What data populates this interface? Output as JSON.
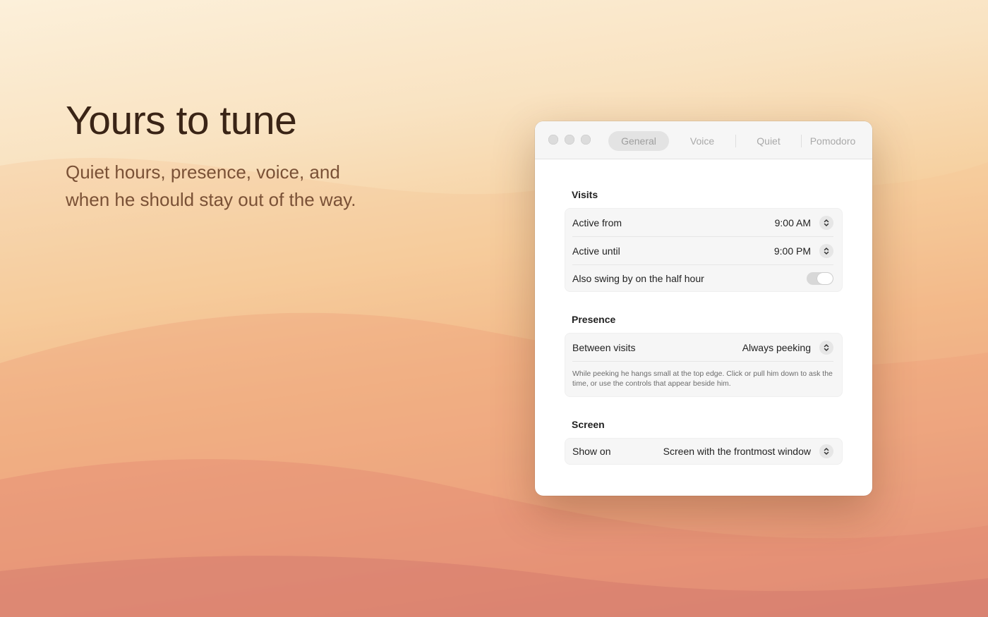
{
  "hero": {
    "title": "Yours to tune",
    "subtitle": "Quiet hours, presence, voice, and when he should stay out of the way."
  },
  "window": {
    "tabs": [
      {
        "label": "General",
        "active": true
      },
      {
        "label": "Voice",
        "active": false
      },
      {
        "label": "Quiet",
        "active": false
      },
      {
        "label": "Pomodoro",
        "active": false
      }
    ]
  },
  "visits": {
    "title": "Visits",
    "active_from": {
      "label": "Active from",
      "value": "9:00 AM"
    },
    "active_until": {
      "label": "Active until",
      "value": "9:00 PM"
    },
    "half_hour": {
      "label": "Also swing by on the half hour",
      "enabled": true
    }
  },
  "presence": {
    "title": "Presence",
    "between_visits": {
      "label": "Between visits",
      "value": "Always peeking"
    },
    "note": "While peeking he hangs small at the top edge. Click or pull him down to ask the time, or use the controls that appear beside him."
  },
  "screen": {
    "title": "Screen",
    "show_on": {
      "label": "Show on",
      "value": "Screen with the frontmost window"
    }
  },
  "colors": {
    "accent_disabled": "#d8d8d8",
    "bg_top": "#fcf0da",
    "bg_bottom": "#c96f6c"
  },
  "icons": [
    "chevron-up-down-icon",
    "toggle-switch"
  ]
}
